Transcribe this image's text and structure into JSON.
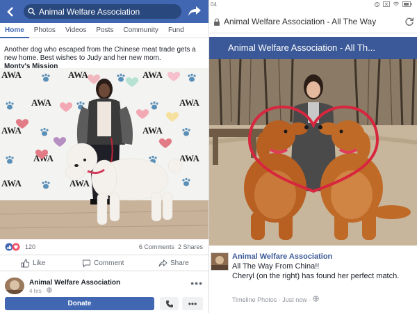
{
  "left": {
    "search": {
      "value": "Animal Welfare Association"
    },
    "tabs": [
      "Home",
      "Photos",
      "Videos",
      "Posts",
      "Community",
      "Fund"
    ],
    "post": {
      "text": "Another dog who escaped from the Chinese meat trade gets a new home. Best wishes to Judy and her new mom.",
      "mission": "Monty's Mission"
    },
    "backdrop_logo": "AWA",
    "reactions": {
      "count": "120",
      "comments": "6 Comments",
      "shares": "2 Shares"
    },
    "actions": {
      "like": "Like",
      "comment": "Comment",
      "share": "Share"
    },
    "footer": {
      "page_name": "Animal Welfare Association",
      "time": "4 hrs ·",
      "more": "•••",
      "donate": "Donate",
      "more2": "•••"
    }
  },
  "right": {
    "status": {
      "clock": "04"
    },
    "url": "Animal Welfare Association - All The Way",
    "page_title": "Animal Welfare Association - All Th...",
    "caption": {
      "name": "Animal Welfare Association",
      "line1": "All The Way From China!!",
      "line2": "Cheryl (on the right) has found her perfect match.",
      "meta": "Timeline Photos · Just now ·"
    }
  },
  "colors": {
    "fb_blue": "#4267b2",
    "fb_header_blue": "#3b5998",
    "heart_red": "#d7263d"
  }
}
